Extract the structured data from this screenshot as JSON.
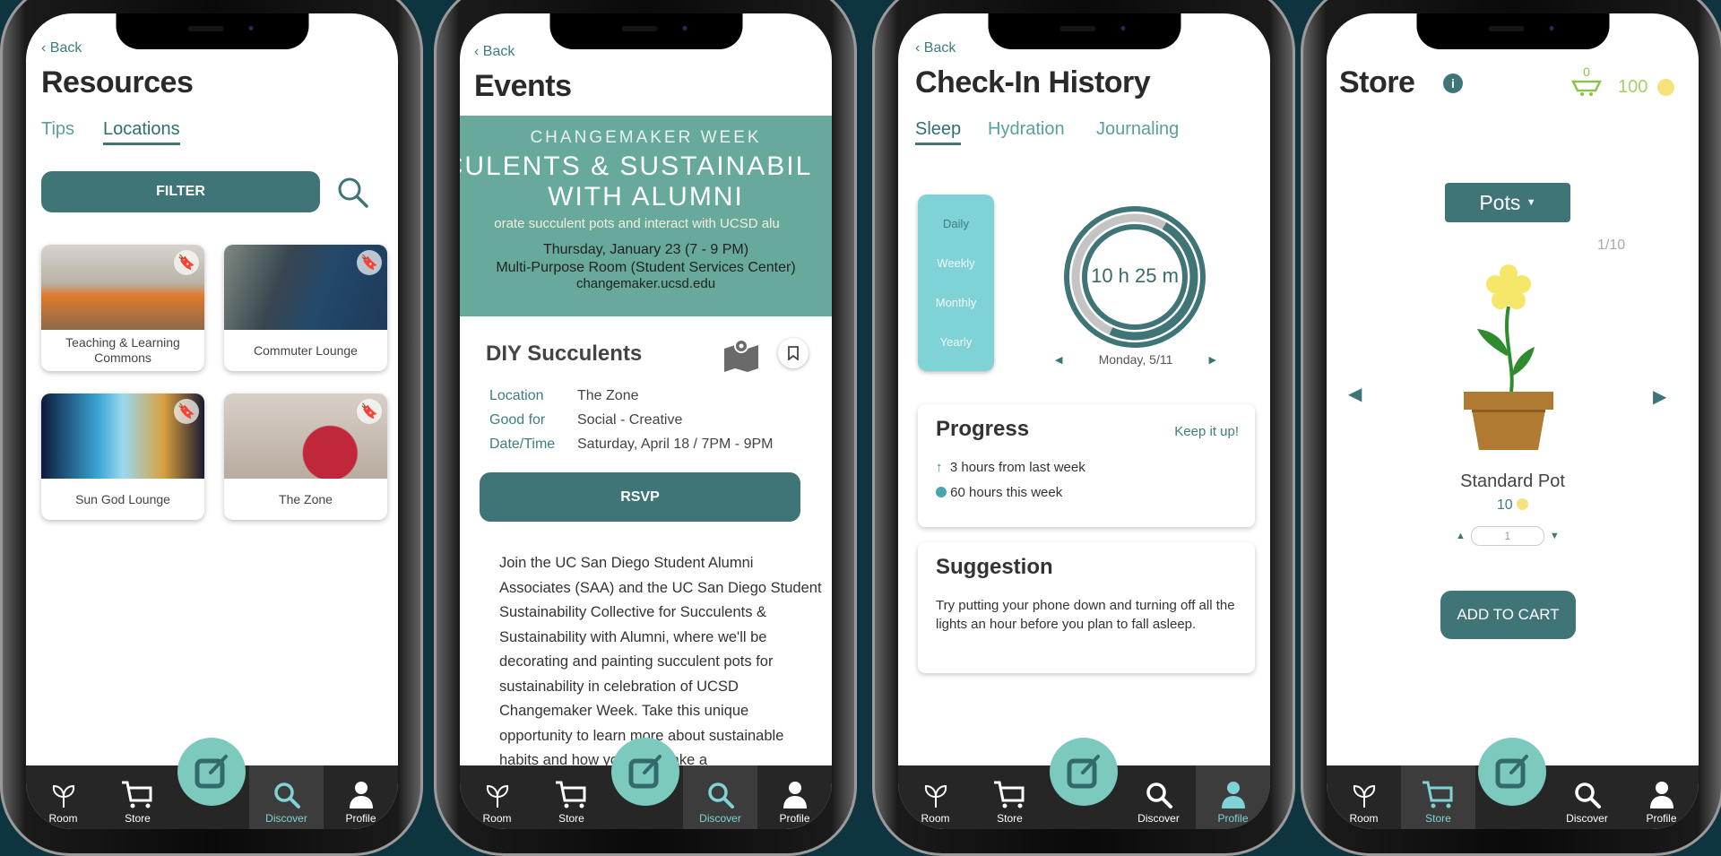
{
  "colors": {
    "background": "#0e3440",
    "primary": "#3f7577",
    "accent": "#7fd3d6",
    "fab": "#7cc9be",
    "nav_bg": "#262626",
    "coin": "#f5e27a",
    "cart": "#8bc34a"
  },
  "nav": [
    {
      "label": "Room",
      "icon": "sprout-icon"
    },
    {
      "label": "Store",
      "icon": "cart-icon"
    },
    {
      "label": "",
      "icon": "edit-icon"
    },
    {
      "label": "Discover",
      "icon": "search-icon"
    },
    {
      "label": "Profile",
      "icon": "person-icon"
    }
  ],
  "resources": {
    "back": "Back",
    "title": "Resources",
    "tabs": [
      {
        "label": "Tips",
        "active": false
      },
      {
        "label": "Locations",
        "active": true
      }
    ],
    "filter": "FILTER",
    "cards": [
      {
        "label": "Teaching & Learning Commons"
      },
      {
        "label": "Commuter Lounge"
      },
      {
        "label": "Sun God Lounge"
      },
      {
        "label": "The Zone"
      }
    ],
    "active_nav": "Discover"
  },
  "events": {
    "back": "Back",
    "title": "Events",
    "banner": {
      "line1": "CHANGEMAKER WEEK",
      "line2": "CULENTS & SUSTAINABIL",
      "line3": "WITH ALUMNI",
      "line4": "orate succulent pots and interact with UCSD alu",
      "line5": "Thursday, January 23 (7 - 9 PM)",
      "line6": "Multi-Purpose Room (Student Services Center)",
      "line7": "changemaker.ucsd.edu"
    },
    "event_title": "DIY Succulents",
    "details": [
      {
        "k": "Location",
        "v": "The Zone"
      },
      {
        "k": "Good for",
        "v": "Social - Creative"
      },
      {
        "k": "Date/Time",
        "v": "Saturday, April 18 / 7PM - 9PM"
      }
    ],
    "rsvp": "RSVP",
    "description": "Join the UC San Diego Student Alumni Associates (SAA) and the UC San Diego Student Sustainability Collective for Succulents & Sustainability with Alumni, where we'll be decorating and painting succulent pots for sustainability in celebration of UCSD Changemaker Week. Take this unique opportunity to learn more about sustainable habits and how you can make a",
    "active_nav": "Discover"
  },
  "checkin": {
    "back": "Back",
    "title": "Check-In History",
    "tabs": [
      {
        "label": "Sleep",
        "active": true
      },
      {
        "label": "Hydration",
        "active": false
      },
      {
        "label": "Journaling",
        "active": false
      }
    ],
    "periods": [
      "Daily",
      "Weekly",
      "Monthly",
      "Yearly"
    ],
    "ring_value": "10 h 25 m",
    "date": "Monday, 5/11",
    "progress": {
      "title": "Progress",
      "cheer": "Keep it up!",
      "line1": "3 hours from last week",
      "line2": "60 hours this week"
    },
    "suggestion": {
      "title": "Suggestion",
      "text": "Try putting your phone down and turning off all the lights an hour before you plan to fall asleep."
    },
    "active_nav": "Profile"
  },
  "store": {
    "title": "Store",
    "cart_count": "0",
    "coins": "100",
    "category": "Pots",
    "page": "1/10",
    "item_name": "Standard Pot",
    "item_price": "10",
    "quantity": "1",
    "add_to_cart": "ADD TO CART",
    "active_nav": "Store"
  }
}
